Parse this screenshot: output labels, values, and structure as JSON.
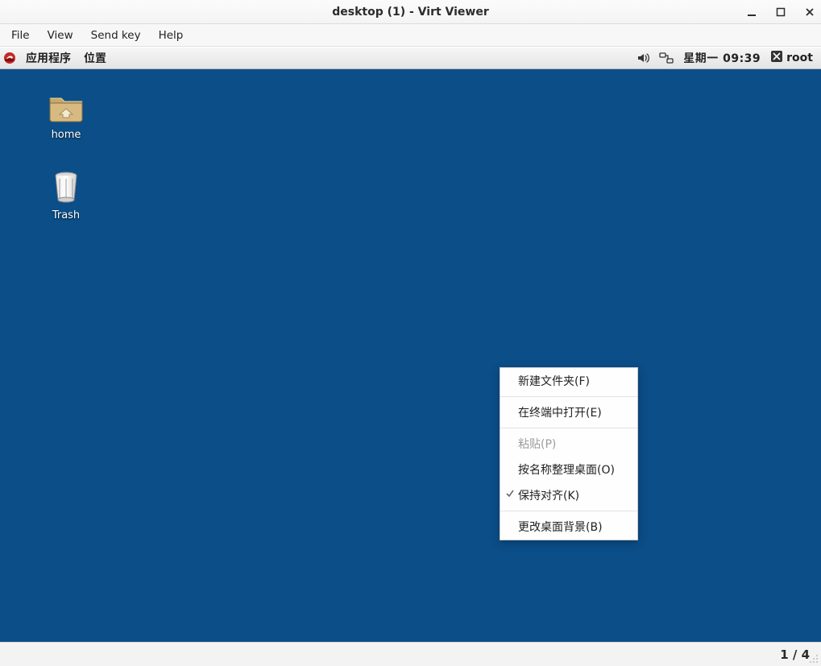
{
  "window": {
    "title": "desktop (1) - Virt Viewer",
    "controls": {
      "minimize": "minimize",
      "maximize": "maximize",
      "close": "close"
    }
  },
  "menubar": {
    "items": [
      "File",
      "View",
      "Send key",
      "Help"
    ]
  },
  "panel": {
    "apps_label": "应用程序",
    "places_label": "位置",
    "clock": "星期一  09:39",
    "user_label": "root",
    "icons": {
      "hat": "fedora-hat-icon",
      "volume": "volume-icon",
      "network": "network-icon",
      "user_badge": "user-badge-icon"
    }
  },
  "desktop_icons": {
    "home_label": "home",
    "trash_label": "Trash"
  },
  "context_menu": {
    "items": [
      {
        "label": "新建文件夹(F)",
        "enabled": true,
        "checked": false
      },
      {
        "sep": true
      },
      {
        "label": "在终端中打开(E)",
        "enabled": true,
        "checked": false
      },
      {
        "sep": true
      },
      {
        "label": "粘贴(P)",
        "enabled": false,
        "checked": false
      },
      {
        "label": "按名称整理桌面(O)",
        "enabled": true,
        "checked": false
      },
      {
        "label": "保持对齐(K)",
        "enabled": true,
        "checked": true
      },
      {
        "sep": true
      },
      {
        "label": "更改桌面背景(B)",
        "enabled": true,
        "checked": false
      }
    ]
  },
  "statusbar": {
    "page_indicator": "1 / 4"
  }
}
